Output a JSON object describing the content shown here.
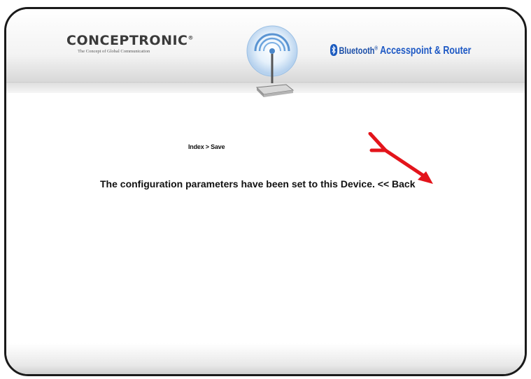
{
  "header": {
    "logo_main": "CONCEPTRONIC",
    "logo_tm": "®",
    "logo_tagline": "The Concept of Global Communication",
    "bluetooth_word": "Bluetooth",
    "bluetooth_tm": "®",
    "product_name": "Accesspoint & Router"
  },
  "main": {
    "breadcrumb": "Index > Save",
    "message": "The configuration parameters have been set to this Device.",
    "back_link": "<< Back"
  },
  "colors": {
    "brand_blue": "#1c5bbf",
    "arrow_red": "#e3141b"
  },
  "icons": {
    "router": "wireless-router-icon",
    "bluetooth": "bluetooth-icon",
    "annotation": "red-arrow-annotation"
  }
}
